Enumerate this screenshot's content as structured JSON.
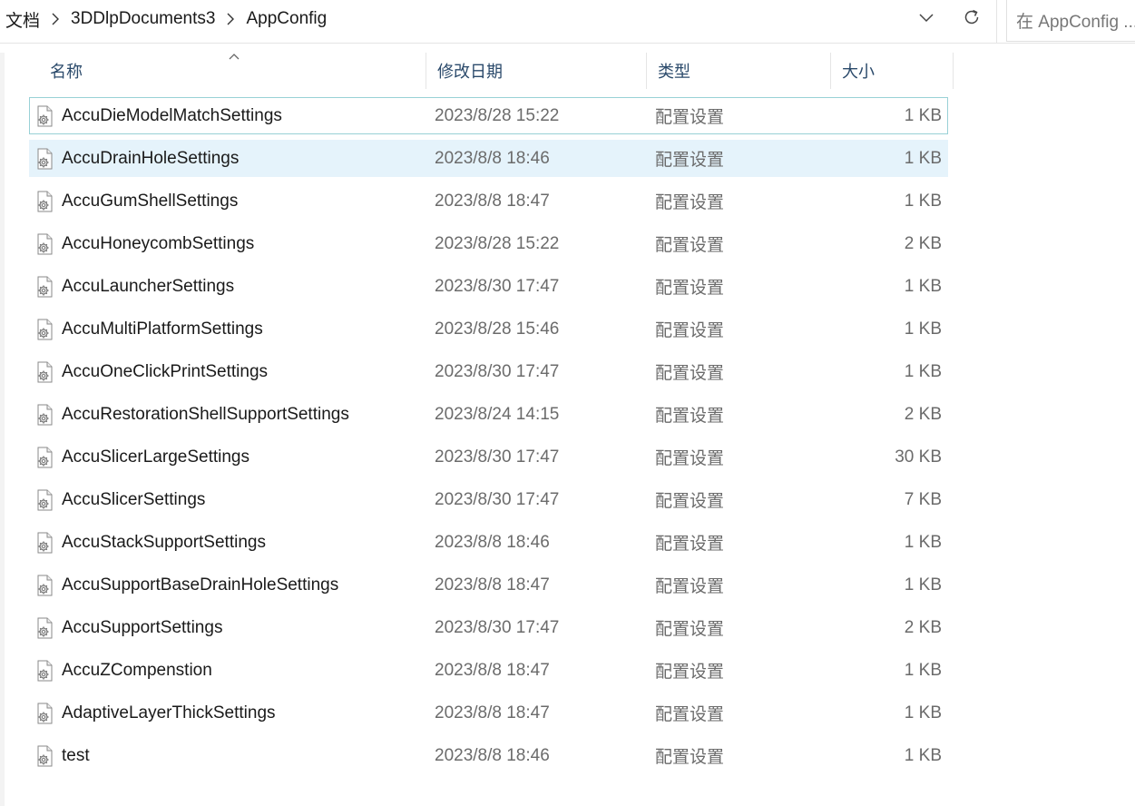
{
  "breadcrumb": {
    "items": [
      "文档",
      "3DDlpDocuments3",
      "AppConfig"
    ]
  },
  "search": {
    "placeholder": "在 AppConfig ..."
  },
  "columns": {
    "name": "名称",
    "date": "修改日期",
    "type": "类型",
    "size": "大小"
  },
  "icons": {
    "breadcrumb_separator": "chevron-right-icon",
    "dropdown": "chevron-down-icon",
    "refresh": "refresh-icon",
    "sort": "sort-up-icon",
    "file": "config-file-icon"
  },
  "files": [
    {
      "name": "AccuDieModelMatchSettings",
      "date": "2023/8/28 15:22",
      "type": "配置设置",
      "size": "1 KB"
    },
    {
      "name": "AccuDrainHoleSettings",
      "date": "2023/8/8 18:46",
      "type": "配置设置",
      "size": "1 KB"
    },
    {
      "name": "AccuGumShellSettings",
      "date": "2023/8/8 18:47",
      "type": "配置设置",
      "size": "1 KB"
    },
    {
      "name": "AccuHoneycombSettings",
      "date": "2023/8/28 15:22",
      "type": "配置设置",
      "size": "2 KB"
    },
    {
      "name": "AccuLauncherSettings",
      "date": "2023/8/30 17:47",
      "type": "配置设置",
      "size": "1 KB"
    },
    {
      "name": "AccuMultiPlatformSettings",
      "date": "2023/8/28 15:46",
      "type": "配置设置",
      "size": "1 KB"
    },
    {
      "name": "AccuOneClickPrintSettings",
      "date": "2023/8/30 17:47",
      "type": "配置设置",
      "size": "1 KB"
    },
    {
      "name": "AccuRestorationShellSupportSettings",
      "date": "2023/8/24 14:15",
      "type": "配置设置",
      "size": "2 KB"
    },
    {
      "name": "AccuSlicerLargeSettings",
      "date": "2023/8/30 17:47",
      "type": "配置设置",
      "size": "30 KB"
    },
    {
      "name": "AccuSlicerSettings",
      "date": "2023/8/30 17:47",
      "type": "配置设置",
      "size": "7 KB"
    },
    {
      "name": "AccuStackSupportSettings",
      "date": "2023/8/8 18:46",
      "type": "配置设置",
      "size": "1 KB"
    },
    {
      "name": "AccuSupportBaseDrainHoleSettings",
      "date": "2023/8/8 18:47",
      "type": "配置设置",
      "size": "1 KB"
    },
    {
      "name": "AccuSupportSettings",
      "date": "2023/8/30 17:47",
      "type": "配置设置",
      "size": "2 KB"
    },
    {
      "name": "AccuZCompenstion",
      "date": "2023/8/8 18:47",
      "type": "配置设置",
      "size": "1 KB"
    },
    {
      "name": "AdaptiveLayerThickSettings",
      "date": "2023/8/8 18:47",
      "type": "配置设置",
      "size": "1 KB"
    },
    {
      "name": "test",
      "date": "2023/8/8 18:46",
      "type": "配置设置",
      "size": "1 KB"
    }
  ],
  "focused_index": 0,
  "selected_index": 1
}
